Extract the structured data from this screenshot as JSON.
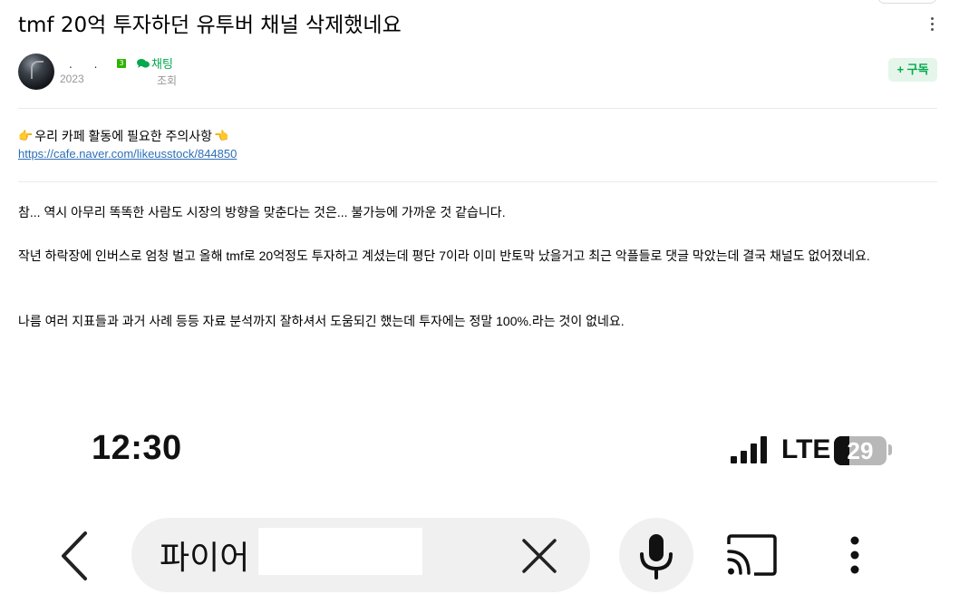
{
  "post": {
    "title": "tmf 20억 투자하던 유투버 채널 삭제했네요",
    "author_dots": ". . .",
    "level_badge": "3",
    "chat_label": "채팅",
    "date": "2023",
    "views_label": "조회",
    "subscribe_label": "+ 구독"
  },
  "notice": {
    "text": "우리 카페 활동에 필요한 주의사항",
    "hand_left": "👉",
    "hand_right": "👈",
    "link": "https://cafe.naver.com/likeusstock/844850"
  },
  "body": {
    "p1": "참... 역시 아무리 똑똑한 사람도 시장의 방향을 맞춘다는 것은... 불가능에 가까운 것 같습니다.",
    "p2": "작년 하락장에 인버스로 엄청 벌고 올해 tmf로 20억정도 투자하고 계셨는데 평단 7이라 이미 반토막 났을거고 최근 악플들로 댓글 막았는데 결국 채널도 없어졌네요.",
    "p3": "나름 여러 지표들과 과거 사례 등등 자료 분석까지 잘하셔서 도움되긴 했는데 투자에는 정말 100%.라는 것이 없네요."
  },
  "phone": {
    "time": "12:30",
    "network": "LTE",
    "battery_level": "29",
    "battery_fraction": 0.29,
    "search_text": "파이어",
    "icons": [
      "back-icon",
      "clear-icon",
      "mic-icon",
      "cast-icon",
      "more-vertical-icon"
    ]
  },
  "colors": {
    "green": "#03a94d",
    "link": "#2d6fb8",
    "pill": "#f0f0f0"
  }
}
